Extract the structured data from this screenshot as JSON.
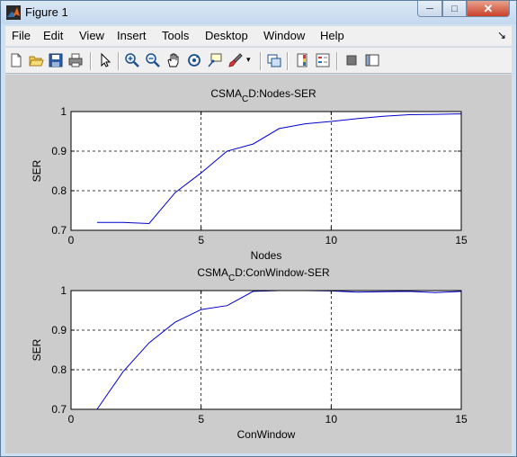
{
  "window": {
    "title": "Figure 1"
  },
  "menu": {
    "items": [
      "File",
      "Edit",
      "View",
      "Insert",
      "Tools",
      "Desktop",
      "Window",
      "Help"
    ]
  },
  "toolbar": {
    "icons": [
      "new-figure-icon",
      "open-file-icon",
      "save-icon",
      "print-icon",
      "select-arrow-icon",
      "zoom-in-icon",
      "zoom-out-icon",
      "pan-hand-icon",
      "rotate-3d-icon",
      "data-cursor-icon",
      "brush-icon",
      "link-plot-icon",
      "colorbar-icon",
      "legend-icon",
      "hide-plot-tools-icon",
      "show-plot-tools-icon"
    ]
  },
  "chart_data": [
    {
      "type": "line",
      "title_main": "CSMA",
      "title_sub": "C",
      "title_rest": "D:Nodes-SER",
      "xlabel": "Nodes",
      "ylabel": "SER",
      "xlim": [
        0,
        15
      ],
      "ylim": [
        0.7,
        1
      ],
      "xticks": [
        0,
        5,
        10,
        15
      ],
      "yticks": [
        0.7,
        0.8,
        0.9,
        1
      ],
      "ytick_labels": [
        "0.7",
        "0.8",
        "0.9",
        "1"
      ],
      "grid": true,
      "color": "#0000cc",
      "x": [
        1,
        2,
        3,
        4,
        5,
        6,
        7,
        8,
        9,
        10,
        11,
        12,
        13,
        14,
        15
      ],
      "y": [
        0.72,
        0.72,
        0.717,
        0.795,
        0.845,
        0.9,
        0.918,
        0.957,
        0.969,
        0.975,
        0.982,
        0.988,
        0.992,
        0.993,
        0.994
      ]
    },
    {
      "type": "line",
      "title_main": "CSMA",
      "title_sub": "C",
      "title_rest": "D:ConWindow-SER",
      "xlabel": "ConWindow",
      "ylabel": "SER",
      "xlim": [
        0,
        15
      ],
      "ylim": [
        0.7,
        1
      ],
      "xticks": [
        0,
        5,
        10,
        15
      ],
      "yticks": [
        0.7,
        0.8,
        0.9,
        1
      ],
      "ytick_labels": [
        "0.7",
        "0.8",
        "0.9",
        "1"
      ],
      "grid": true,
      "color": "#0000cc",
      "x": [
        1,
        2,
        3,
        4,
        5,
        6,
        7,
        8,
        9,
        10,
        11,
        12,
        13,
        14,
        15
      ],
      "y": [
        0.7,
        0.795,
        0.868,
        0.92,
        0.952,
        0.962,
        0.998,
        1.0,
        1.0,
        0.999,
        0.996,
        0.997,
        0.998,
        0.995,
        0.998
      ]
    }
  ]
}
